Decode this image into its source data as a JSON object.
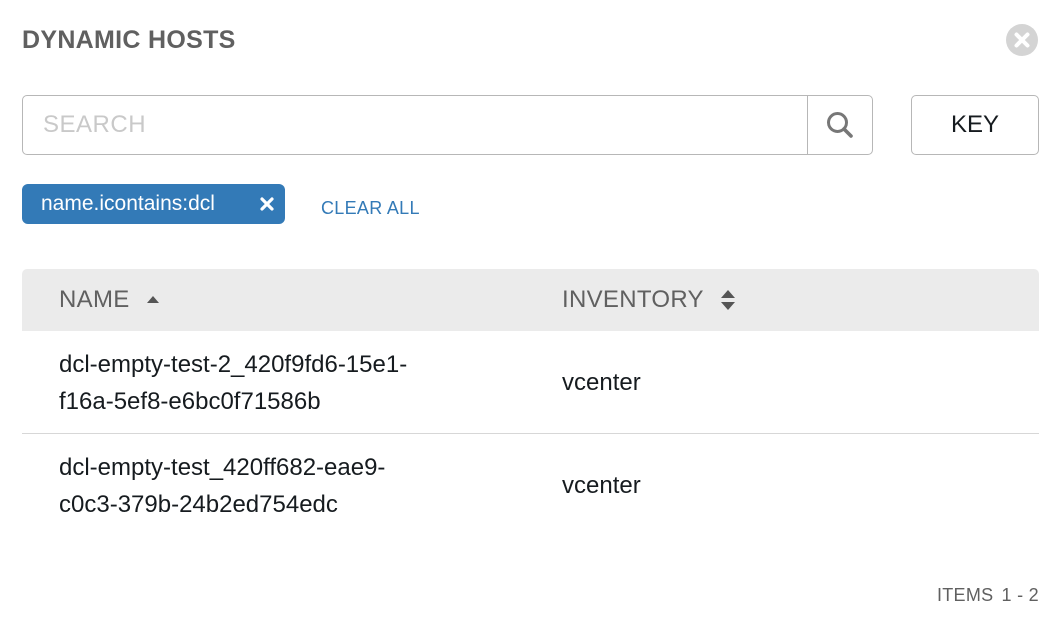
{
  "modal": {
    "title": "DYNAMIC HOSTS",
    "close_icon": "close-circle-icon"
  },
  "search": {
    "placeholder": "SEARCH",
    "value": "",
    "icon": "search-icon"
  },
  "key_button": {
    "label": "KEY"
  },
  "filters": {
    "tags": [
      {
        "label": "name.icontains:dcl",
        "remove_icon": "close-x-icon"
      }
    ],
    "clear_all_label": "CLEAR ALL"
  },
  "table": {
    "columns": [
      {
        "label": "NAME",
        "sort": "ascending",
        "sort_icon": "caret-up-icon"
      },
      {
        "label": "INVENTORY",
        "sort": "none",
        "sort_icon": "sort-both-icon"
      }
    ],
    "rows": [
      {
        "name_line1": "dcl-empty-test-2_420f9fd6-15e1-",
        "name_line2": "f16a-5ef8-e6bc0f71586b",
        "inventory": "vcenter"
      },
      {
        "name_line1": "dcl-empty-test_420ff682-eae9-",
        "name_line2": "c0c3-379b-24b2ed754edc",
        "inventory": "vcenter"
      }
    ]
  },
  "pagination": {
    "label": "ITEMS",
    "range": "1 - 2"
  },
  "colors": {
    "accent": "#337ab7",
    "header_bg": "#ebebeb",
    "title_text": "#606060",
    "close_bg": "#d4d4d4"
  }
}
